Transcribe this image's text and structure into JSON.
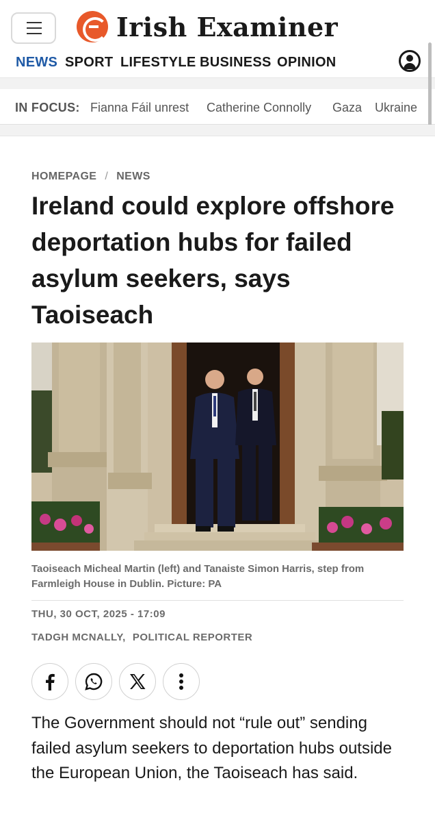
{
  "header": {
    "logo_text": "Irish Examiner",
    "nav": [
      "NEWS",
      "SPORT",
      "LIFESTYLE",
      "BUSINESS",
      "OPINION"
    ],
    "active_nav": "NEWS",
    "accent_color": "#1f5aa6",
    "logo_color": "#e8592a"
  },
  "in_focus": {
    "label": "IN FOCUS:",
    "items": [
      "Fianna Fáil unrest",
      "Catherine Connolly",
      "Gaza",
      "Ukraine"
    ]
  },
  "article": {
    "breadcrumb": [
      "HOMEPAGE",
      "NEWS"
    ],
    "breadcrumb_sep": "/",
    "headline": "Ireland could explore offshore deportation hubs for failed asylum seekers, says Taoiseach",
    "caption": "Taoiseach Micheal Martin (left) and Tanaiste Simon Harris, step from Farmleigh House in Dublin. Picture: PA",
    "date": "THU, 30 OCT, 2025 - 17:09",
    "author": "TADGH MCNALLY,",
    "author_role": "POLITICAL REPORTER",
    "share_icons": [
      "facebook-icon",
      "whatsapp-icon",
      "x-icon",
      "more-icon"
    ],
    "body": "The Government should not “rule out” sending failed asylum seekers to deportation hubs outside the European Union, the Taoiseach has said."
  }
}
